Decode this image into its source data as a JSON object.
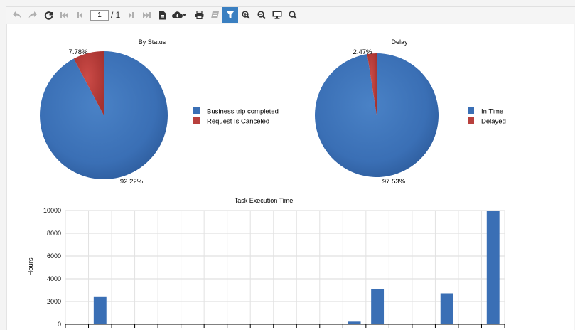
{
  "toolbar": {
    "page_current": "1",
    "page_total": "/ 1",
    "icons": [
      "undo-icon",
      "redo-icon",
      "refresh-icon",
      "first-page-icon",
      "prev-page-icon",
      "next-page-icon",
      "last-page-icon",
      "document-icon",
      "cloud-download-icon",
      "print-icon",
      "print-layout-icon",
      "filter-icon",
      "zoom-in-icon",
      "zoom-out-icon",
      "presentation-icon",
      "search-icon"
    ]
  },
  "colors": {
    "blue": "#3a6fb5",
    "red": "#b8403d",
    "accent": "#3a7fc1"
  },
  "chart_data": [
    {
      "type": "pie",
      "title": "By Status",
      "labels": [
        "Business trip completed",
        "Request Is Canceled"
      ],
      "values": [
        92.22,
        7.78
      ],
      "value_labels": [
        "92.22%",
        "7.78%"
      ],
      "legend": "right"
    },
    {
      "type": "pie",
      "title": "Delay",
      "labels": [
        "In Time",
        "Delayed"
      ],
      "values": [
        97.53,
        2.47
      ],
      "value_labels": [
        "97.53%",
        "2.47%"
      ],
      "legend": "right"
    },
    {
      "type": "bar",
      "title": "Task Execution Time",
      "ylabel": "Hours",
      "ylim": [
        0,
        10000
      ],
      "yticks": [
        "0",
        "2000",
        "4000",
        "6000",
        "8000",
        "10000"
      ],
      "values": [
        0,
        2450,
        0,
        0,
        0,
        0,
        0,
        0,
        0,
        0,
        0,
        0,
        230,
        3080,
        0,
        0,
        2720,
        0,
        9950
      ],
      "grid": true
    }
  ]
}
